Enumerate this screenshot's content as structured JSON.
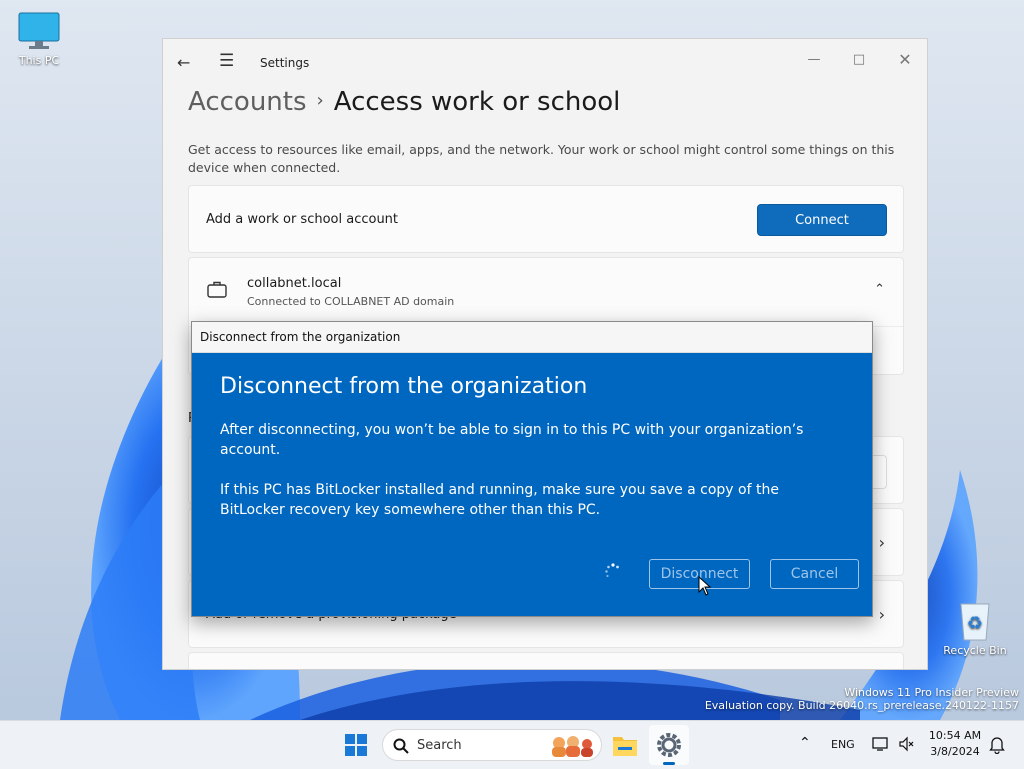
{
  "desktop": {
    "this_pc_label": "This PC",
    "recycle_bin_label": "Recycle Bin",
    "watermark_line1": "Windows 11 Pro Insider Preview",
    "watermark_line2": "Evaluation copy. Build 26040.rs_prerelease.240122-1157"
  },
  "settings": {
    "window_title": "Settings",
    "breadcrumb_parent": "Accounts",
    "breadcrumb_current": "Access work or school",
    "description": "Get access to resources like email, apps, and the network. Your work or school might control some things on this device when connected.",
    "add_account_label": "Add a work or school account",
    "connect_button": "Connect",
    "account": {
      "name": "collabnet.local",
      "status": "Connected to COLLABNET AD domain"
    },
    "hidden_row_label": "Add or remove a provisioning package",
    "partial_section_label": "R"
  },
  "dialog": {
    "window_title": "Disconnect from the organization",
    "heading": "Disconnect from the organization",
    "paragraph1": "After disconnecting, you won’t be able to sign in to this PC with your organization’s account.",
    "paragraph2": "If this PC has BitLocker installed and running, make sure you save a copy of the BitLocker recovery key somewhere other than this PC.",
    "disconnect_button": "Disconnect",
    "cancel_button": "Cancel"
  },
  "taskbar": {
    "search_placeholder": "Search",
    "language": "ENG",
    "time": "10:54 AM",
    "date": "3/8/2024"
  },
  "colors": {
    "accent": "#0067c0",
    "connect_button": "#0f6cbd"
  },
  "icons": [
    "back-arrow-icon",
    "hamburger-menu-icon",
    "minimize-icon",
    "maximize-icon",
    "close-icon",
    "briefcase-icon",
    "chevron-up-icon",
    "chevron-right-icon",
    "spinner-icon",
    "windows-start-icon",
    "search-icon",
    "file-explorer-icon",
    "settings-gear-icon",
    "chevron-up-tray-icon",
    "network-icon",
    "speaker-icon",
    "notification-bell-icon",
    "monitor-icon",
    "recycle-bin-icon"
  ]
}
